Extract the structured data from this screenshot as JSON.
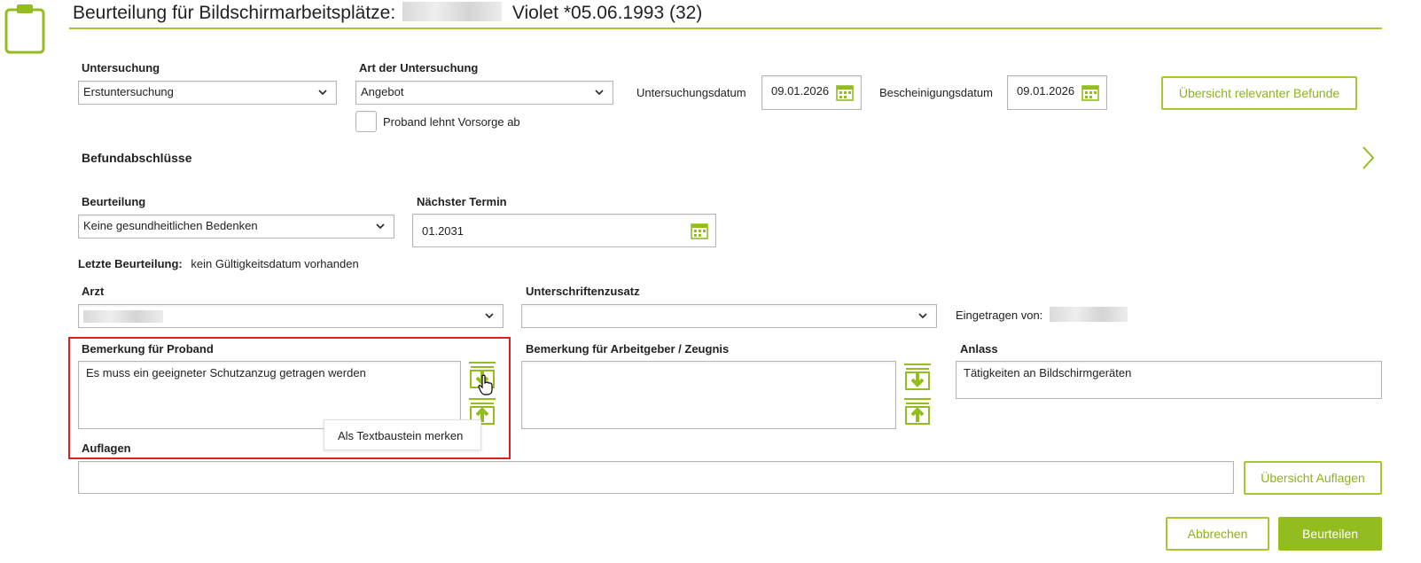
{
  "header": {
    "title_prefix": "Beurteilung für Bildschirmarbeitsplätze:",
    "patient_name": "Violet *05.06.1993 (32)"
  },
  "untersuchung": {
    "label": "Untersuchung",
    "value": "Erstuntersuchung"
  },
  "art": {
    "label": "Art der Untersuchung",
    "value": "Angebot",
    "decline_checkbox_label": "Proband lehnt Vorsorge ab"
  },
  "untersuchungsdatum": {
    "label": "Untersuchungsdatum",
    "value": "09.01.2026"
  },
  "bescheinigungsdatum": {
    "label": "Bescheinigungsdatum",
    "value": "09.01.2026"
  },
  "befunde_button": "Übersicht relevanter Befunde",
  "befundabschluesse": {
    "title": "Befundabschlüsse"
  },
  "beurteilung": {
    "label": "Beurteilung",
    "value": "Keine gesundheitlichen Bedenken"
  },
  "naechster_termin": {
    "label": "Nächster Termin",
    "value": "01.2031"
  },
  "letzte_beurteilung": {
    "label": "Letzte Beurteilung:",
    "value": "kein Gültigkeitsdatum vorhanden"
  },
  "arzt": {
    "label": "Arzt",
    "value": ""
  },
  "unterschriftenzusatz": {
    "label": "Unterschriftenzusatz",
    "value": ""
  },
  "eingetragen_von": {
    "label": "Eingetragen von:"
  },
  "bemerkung_proband": {
    "label": "Bemerkung für Proband",
    "value": "Es muss ein geeigneter Schutzanzug getragen werden",
    "tooltip": "Als Textbaustein merken"
  },
  "bemerkung_arbeitgeber": {
    "label": "Bemerkung für Arbeitgeber / Zeugnis",
    "value": ""
  },
  "anlass": {
    "label": "Anlass",
    "value": "Tätigkeiten an Bildschirmgeräten"
  },
  "auflagen": {
    "label": "Auflagen",
    "value": "",
    "button": "Übersicht Auflagen"
  },
  "footer": {
    "cancel": "Abbrechen",
    "submit": "Beurteilen"
  },
  "colors": {
    "accent": "#93bd1f",
    "highlight": "#e02020"
  },
  "icons": [
    "clipboard-icon",
    "calendar-icon",
    "chevron-down-icon",
    "chevron-right-icon",
    "text-block-download-icon",
    "text-block-upload-icon",
    "hand-cursor-icon"
  ]
}
